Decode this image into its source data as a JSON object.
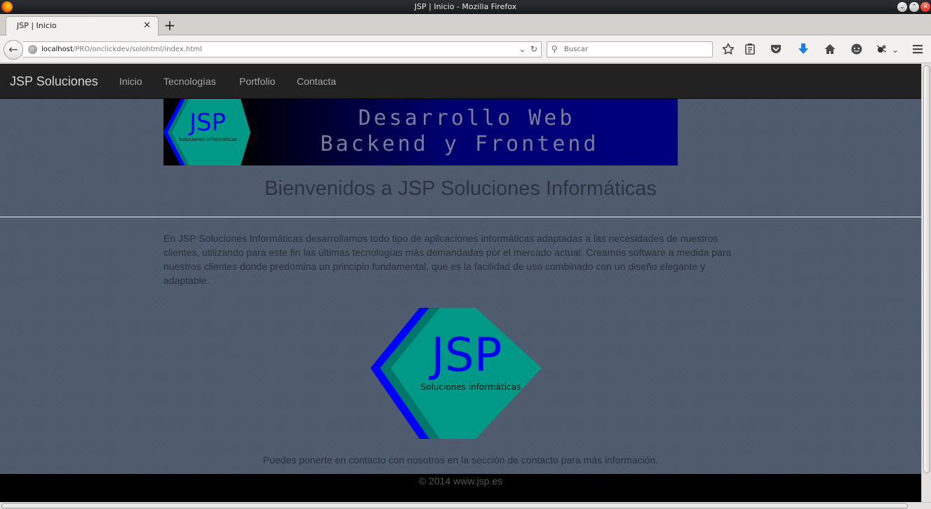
{
  "window": {
    "title": "JSP | Inicio - Mozilla Firefox",
    "controls": {
      "minimize": "⌄",
      "maximize": "⌃",
      "close": "✕"
    }
  },
  "tabs": [
    {
      "label": "JSP | Inicio",
      "close": "✕"
    }
  ],
  "new_tab_label": "+",
  "toolbar": {
    "back": "←",
    "url_host": "localhost",
    "url_path": "/PRO/onclickdev/solohtml/index.html",
    "url_dropdown": "⌄",
    "reload": "↻",
    "search_placeholder": "Buscar",
    "search_icon": "⚲",
    "icons": [
      "star-icon",
      "reading-list-icon",
      "pocket-icon",
      "downloads-icon",
      "home-icon",
      "chat-icon",
      "extension-icon",
      "chevron-down-icon",
      "menu-icon"
    ]
  },
  "site": {
    "brand": "JSP Soluciones",
    "nav": [
      "Inicio",
      "Tecnologías",
      "Portfolio",
      "Contacta"
    ],
    "banner": {
      "logo_text": "JSP",
      "logo_sub": "Soluciones informáticas",
      "line1": "Desarrollo Web",
      "line2": "Backend y Frontend"
    },
    "headline": "Bienvenidos a JSP Soluciones Informáticas",
    "intro": "En JSP Soluciones Informáticas desarrollamos todo tipo de aplicaciones informáticas adaptadas a las necesidades de nuestros clientes, utilizando para este fin las últimas tecnologías más demandadas por el mercado actual. Creamos software a medida para nuestros clientes donde predomina un principio fundamental, que es la facilidad de uso combinado con un diseño elegante y adaptable.",
    "logo": {
      "text": "JSP",
      "sub": "Soluciones informáticas"
    },
    "contact_note": "Puedes ponerte en contacto con nosotros en la sección de contacto para más información.",
    "footer": "© 2014 www.jsp.es"
  },
  "colors": {
    "page_bg": "#4f5b6e",
    "nav_bg": "#222222",
    "logo_teal": "#009988",
    "logo_blue": "#0000ff",
    "banner_blue": "#000080"
  }
}
